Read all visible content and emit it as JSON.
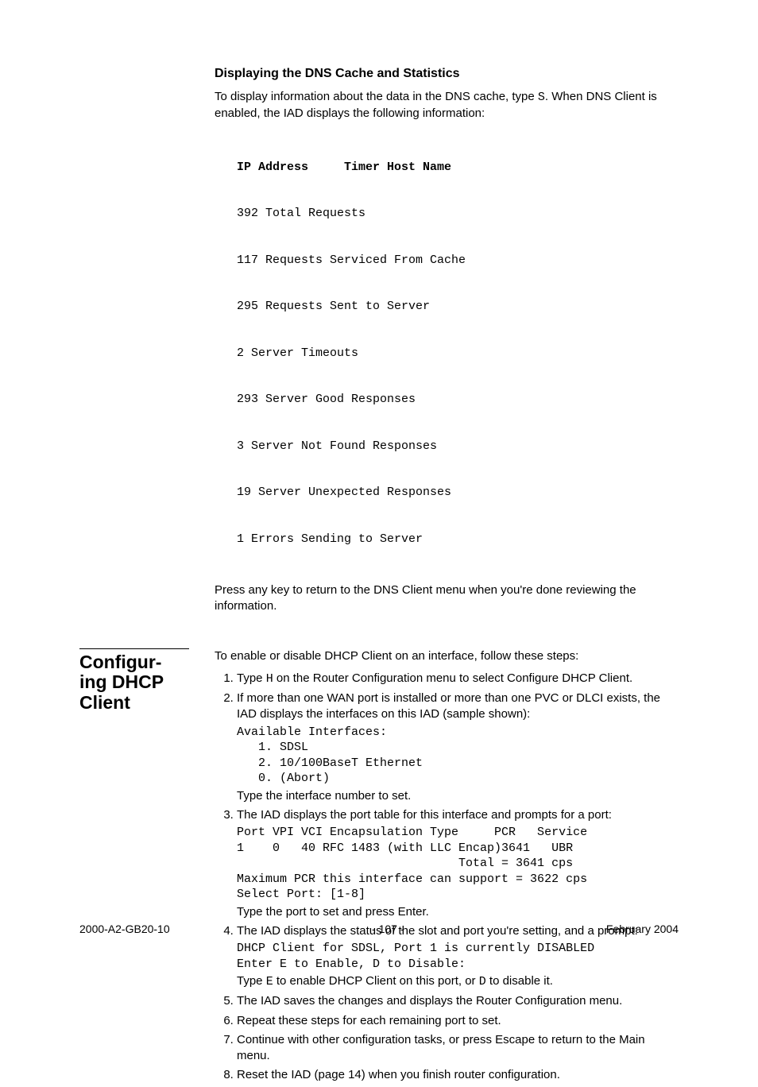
{
  "section1": {
    "heading": "Displaying the DNS Cache and Statistics",
    "intro_part1": "To display information about the data in the DNS cache, type ",
    "intro_code": "S",
    "intro_part2": ". When DNS Client is enabled, the IAD displays the following information:",
    "code_header": "IP Address     Timer Host Name",
    "code_lines": [
      "392 Total Requests",
      "117 Requests Serviced From Cache",
      "295 Requests Sent to Server",
      "2 Server Timeouts",
      "293 Server Good Responses",
      "3 Server Not Found Responses",
      "19 Server Unexpected Responses",
      "1 Errors Sending to Server"
    ],
    "outro": "Press any key to return to the DNS Client menu when you're done reviewing the information."
  },
  "section2": {
    "title_line1": "Configur-",
    "title_line2": "ing DHCP",
    "title_line3": "Client",
    "intro": "To enable or disable DHCP Client on an interface, follow these steps:",
    "step1_a": "Type ",
    "step1_code": "H",
    "step1_b": " on the Router Configuration menu to select Configure DHCP Client.",
    "step2_text": "If more than one WAN port is installed or more than one PVC or DLCI exists, the IAD displays the interfaces on this IAD (sample shown):",
    "step2_code": "Available Interfaces:\n   1. SDSL\n   2. 10/100BaseT Ethernet\n   0. (Abort)",
    "step2_after": "Type the interface number to set.",
    "step3_text": "The IAD displays the port table for this interface and prompts for a port:",
    "step3_code": "Port VPI VCI Encapsulation Type     PCR   Service\n1    0   40 RFC 1483 (with LLC Encap)3641   UBR\n                               Total = 3641 cps\nMaximum PCR this interface can support = 3622 cps\nSelect Port: [1-8]",
    "step3_after": "Type the port to set and press Enter.",
    "step4_text": "The IAD displays the status of the slot and port you're setting, and a prompt:",
    "step4_code": "DHCP Client for SDSL, Port 1 is currently DISABLED\nEnter E to Enable, D to Disable:",
    "step4_after_a": "Type ",
    "step4_code_e": "E",
    "step4_after_b": " to enable DHCP Client on this port, or ",
    "step4_code_d": "D",
    "step4_after_c": " to disable it.",
    "step5": "The IAD saves the changes and displays the Router Configuration menu.",
    "step6": "Repeat these steps for each remaining port to set.",
    "step7": "Continue with other configuration tasks, or press Escape to return to the Main menu.",
    "step8": "Reset the IAD (page 14) when you finish router configuration."
  },
  "footer": {
    "left": "2000-A2-GB20-10",
    "center": "- 107 -",
    "right": "February 2004"
  }
}
